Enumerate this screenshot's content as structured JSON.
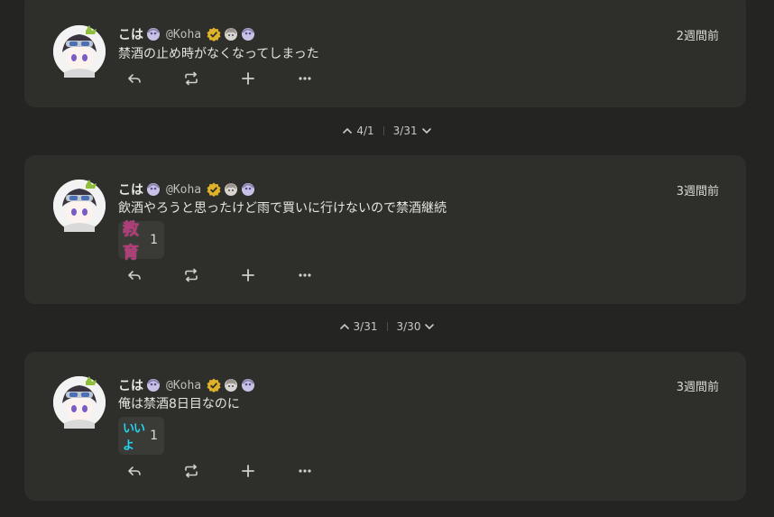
{
  "notes": [
    {
      "user": {
        "name": "こは",
        "username": "@Koha"
      },
      "time": "2週間前",
      "text": "禁酒の止め時がなくなってしまった",
      "reactions": []
    },
    {
      "user": {
        "name": "こは",
        "username": "@Koha"
      },
      "time": "3週間前",
      "text": "飲酒やろうと思ったけど雨で買いに行けないので禁酒継続",
      "reactions": [
        {
          "emoji_text": "教育",
          "count": "1"
        }
      ]
    },
    {
      "user": {
        "name": "こは",
        "username": "@Koha"
      },
      "time": "3週間前",
      "text": "俺は禁酒8日目なのに",
      "reactions": [
        {
          "emoji_text": "いいよ",
          "count": "1"
        }
      ]
    }
  ],
  "separators": [
    {
      "prev": "4/1",
      "next": "3/31"
    },
    {
      "prev": "3/31",
      "next": "3/30"
    }
  ],
  "icons": {
    "reply": "reply-icon",
    "renote": "repeat-icon",
    "react": "plus-icon",
    "more": "more-icon",
    "verified": "verified-badge-icon",
    "chevron_up": "chevron-up-icon",
    "chevron_down": "chevron-down-icon"
  },
  "colors": {
    "background": "#242422",
    "card": "#2e2e2b",
    "verified_badge": "#e0b22a",
    "reaction_kyoiku": "#b23a78",
    "reaction_iiyo": "#23d6f0"
  }
}
